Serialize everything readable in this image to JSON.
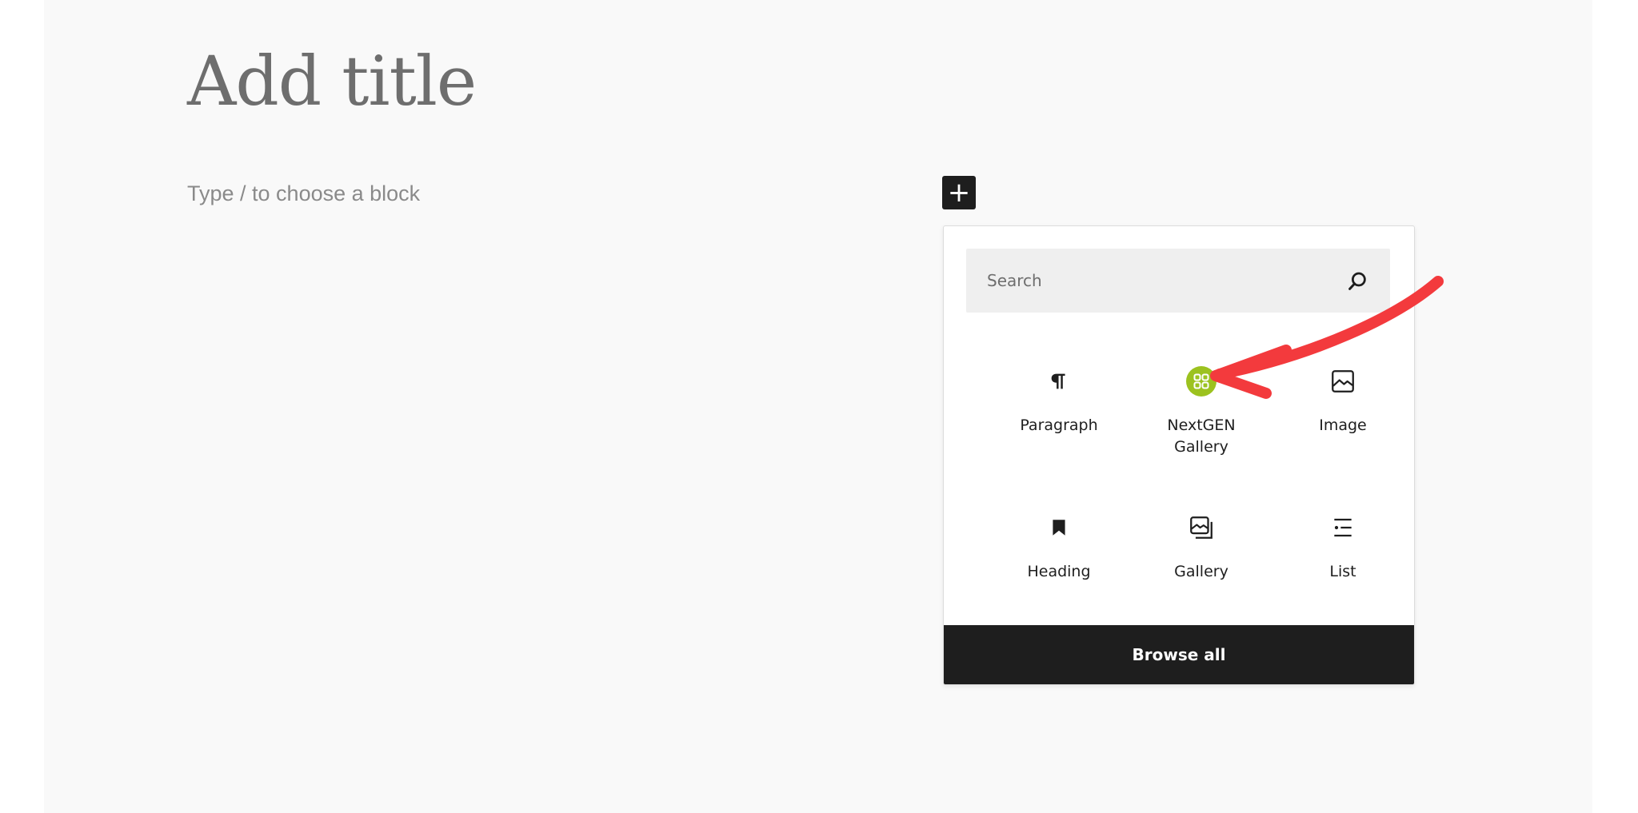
{
  "editor": {
    "title_placeholder": "Add title",
    "block_placeholder": "Type / to choose a block"
  },
  "inserter": {
    "toggle_symbol": "+",
    "search_placeholder": "Search",
    "blocks": [
      {
        "label": "Paragraph",
        "icon": "paragraph-icon"
      },
      {
        "label": "NextGEN Gallery",
        "icon": "nextgen-gallery-icon"
      },
      {
        "label": "Image",
        "icon": "image-icon"
      },
      {
        "label": "Heading",
        "icon": "heading-bookmark-icon"
      },
      {
        "label": "Gallery",
        "icon": "gallery-icon"
      },
      {
        "label": "List",
        "icon": "list-icon"
      }
    ],
    "browse_all_label": "Browse all"
  },
  "colors": {
    "nextgen_green": "#9cc21f",
    "annotation_red": "#f33a3d",
    "dark": "#1e1e1e"
  }
}
